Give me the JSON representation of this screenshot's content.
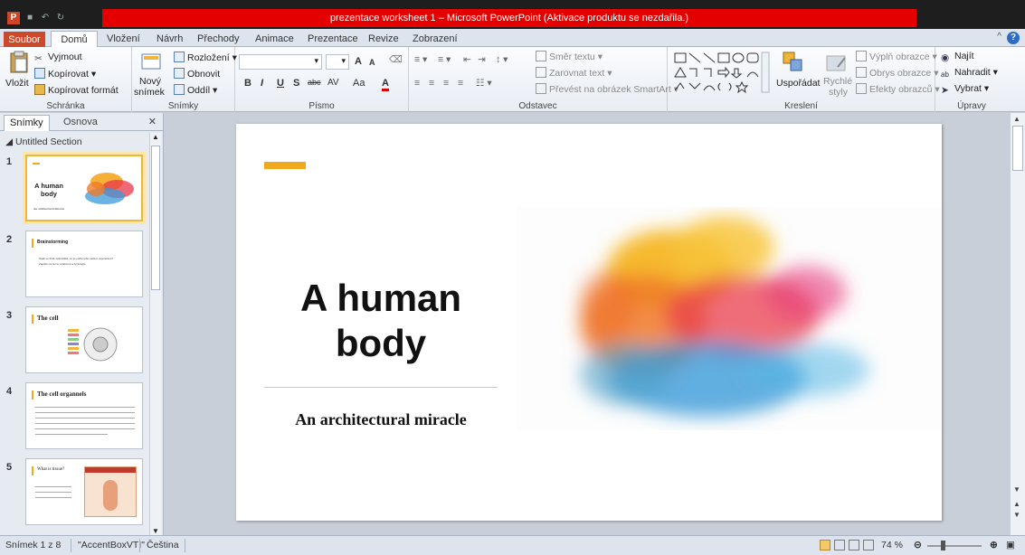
{
  "window": {
    "title": "prezentace worksheet 1 – Microsoft PowerPoint (Aktivace produktu se nezdařila.)"
  },
  "tabs": {
    "file": "Soubor",
    "items": [
      "Domů",
      "Vložení",
      "Návrh",
      "Přechody",
      "Animace",
      "Prezentace",
      "Revize",
      "Zobrazení"
    ]
  },
  "ribbon": {
    "clipboard": {
      "paste": "Vložit",
      "cut": "Vyjmout",
      "copy": "Kopírovat",
      "format_painter": "Kopírovat formát",
      "label": "Schránka"
    },
    "slides": {
      "new_slide_1": "Nový",
      "new_slide_2": "snímek",
      "layout": "Rozložení",
      "reset": "Obnovit",
      "section": "Oddíl",
      "label": "Snímky"
    },
    "font": {
      "label": "Písmo",
      "bold": "B",
      "italic": "I",
      "underline": "U",
      "shadow": "S",
      "strike": "abc",
      "spacing": "AV",
      "case": "Aa",
      "color": "A",
      "grow": "A",
      "shrink": "A"
    },
    "paragraph": {
      "label": "Odstavec",
      "text_direction": "Směr textu",
      "align_text": "Zarovnat text",
      "smartart": "Převést na obrázek SmartArt"
    },
    "drawing": {
      "label": "Kreslení",
      "arrange": "Uspořádat",
      "quick_styles_1": "Rychlé",
      "quick_styles_2": "styly",
      "fill": "Výplň obrazce",
      "outline": "Obrys obrazce",
      "effects": "Efekty obrazců"
    },
    "editing": {
      "label": "Úpravy",
      "find": "Najít",
      "replace": "Nahradit",
      "select": "Vybrat"
    }
  },
  "left_panel": {
    "tabs": [
      "Snímky",
      "Osnova"
    ],
    "section": "Untitled Section",
    "slides": [
      {
        "num": "1",
        "title": "A human body",
        "sub": "An architectural miracle"
      },
      {
        "num": "2",
        "title": "Brainstorming",
        "lines": [
          "Najdi ve třídě spáružáka, co je podle tebe plošné organizace?",
          "Zapište na téma: anatomie a fyziologie"
        ]
      },
      {
        "num": "3",
        "title": "The cell"
      },
      {
        "num": "4",
        "title": "The cell organnels"
      },
      {
        "num": "5",
        "title": "What is tissue?"
      }
    ]
  },
  "slide": {
    "title": "A human body",
    "subtitle": "An architectural miracle"
  },
  "status": {
    "slide_info": "Snímek 1 z 8",
    "theme": "\"AccentBoxVTI\"",
    "language": "Čeština",
    "zoom": "74 %",
    "zoom_fraction": 0.74
  },
  "colors": {
    "accent": "#f2a81d",
    "file_tab": "#cc4a2a",
    "titlebar_warning": "#e50000"
  }
}
